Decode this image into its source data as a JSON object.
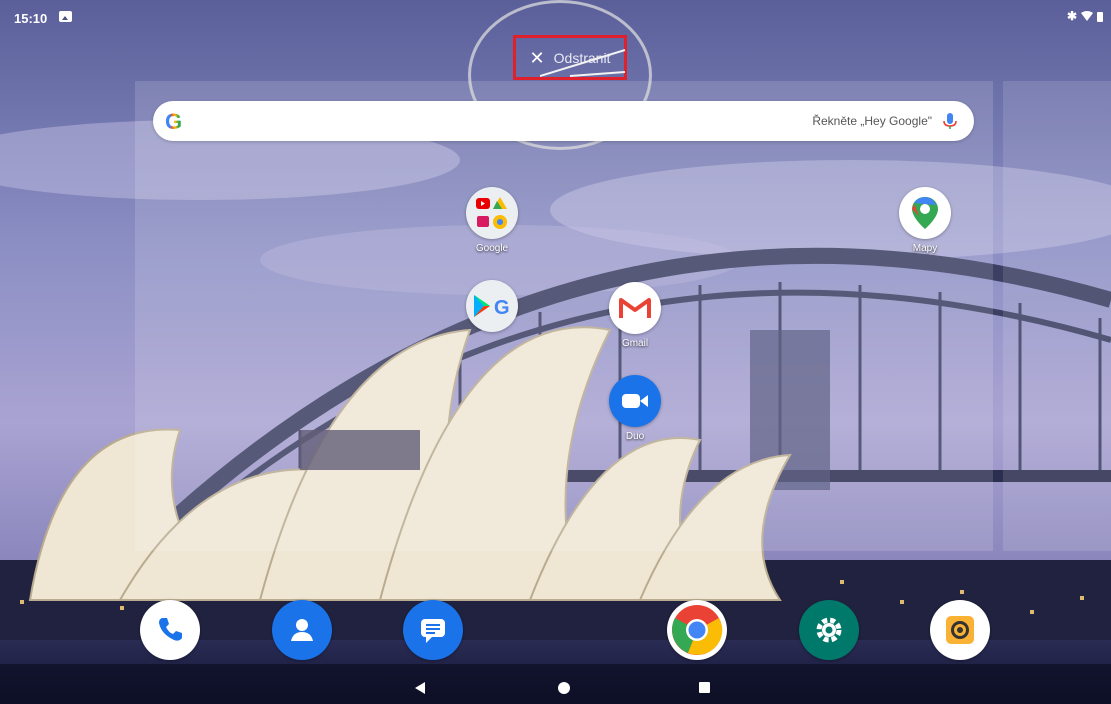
{
  "status_bar": {
    "time": "15:10",
    "left_icons": [
      "image-icon"
    ],
    "right_icons": [
      "bluetooth-icon",
      "wifi-icon",
      "battery-icon"
    ]
  },
  "remove_target": {
    "label": "Odstranit",
    "icon": "close-icon",
    "highlight_color": "#e0202a"
  },
  "search": {
    "logo": "G",
    "hint": "Řekněte „Hey Google\"",
    "mic_icon": "mic-icon"
  },
  "home_apps": [
    {
      "label": "Google",
      "icon": "google-folder-icon"
    },
    {
      "label": "Mapy",
      "icon": "maps-icon"
    },
    {
      "label": "",
      "icon": "play-google-folder-icon"
    },
    {
      "label": "Gmail",
      "icon": "gmail-icon"
    },
    {
      "label": "Duo",
      "icon": "duo-icon"
    }
  ],
  "dock": [
    {
      "icon": "phone-icon"
    },
    {
      "icon": "contacts-icon"
    },
    {
      "icon": "messages-icon"
    },
    {
      "icon": "chrome-icon"
    },
    {
      "icon": "settings-icon"
    },
    {
      "icon": "camera-icon"
    }
  ],
  "navigation": [
    "back-icon",
    "home-icon",
    "recents-icon"
  ]
}
